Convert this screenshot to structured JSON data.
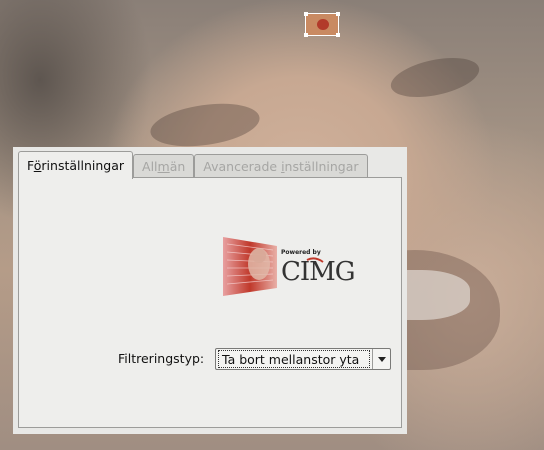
{
  "background": {
    "description_icon": "photo-background"
  },
  "thumbnail": {
    "icon": "preview-thumbnail-icon"
  },
  "dialog": {
    "tabs": [
      {
        "label_pre": "F",
        "label_underlined": "ö",
        "label_post": "rinställningar",
        "active": true
      },
      {
        "label_pre": "All",
        "label_underlined": "m",
        "label_post": "än",
        "active": false
      },
      {
        "label_pre": "Avancerade ",
        "label_underlined": "i",
        "label_post": "nställningar",
        "active": false
      }
    ],
    "logo": {
      "powered_by": "Powered by",
      "brand": "CImg"
    },
    "filter": {
      "label": "Filtreringstyp:",
      "value": "Ta bort mellanstor yta"
    }
  },
  "colors": {
    "dialog_bg": "#eeeeec",
    "border": "#9c9c9a",
    "logo_red": "#c0392b"
  }
}
